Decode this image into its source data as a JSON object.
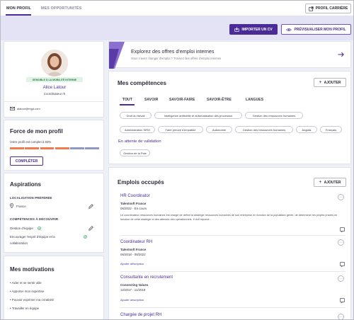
{
  "topnav": {
    "tabs": [
      {
        "label": "MON PROFIL",
        "active": true
      },
      {
        "label": "MES OPPORTUNITÉS",
        "active": false
      }
    ],
    "career_profile_button": "PROFIL CARRIÈRE"
  },
  "band": {
    "import_cv_button": "IMPORTER UN CV",
    "preview_button": "PRÉVISUALISER MON PROFIL"
  },
  "profile": {
    "badge": "SENSIBLE À LA MOBILITÉ INTERNE",
    "name": "Alice Latour",
    "role": "Coordinateur rh",
    "email": "alatour@mgd.com"
  },
  "strength": {
    "title": "Force de mon profil",
    "text": "Votre profil est complet à 83%",
    "percent": 83,
    "segment_colors": [
      "#f07b4f",
      "#f07b4f",
      "#f07b4f",
      "#f07b4f",
      "#8f96c8",
      "#8f96c8"
    ],
    "complete_button": "COMPLÉTER"
  },
  "aspirations": {
    "title": "Aspirations",
    "location_label": "LOCALISATION PRÉFÉRÉE",
    "location_value": "France",
    "skills_label": "COMPÉTENCES À DÉCOUVRIR",
    "skills": [
      "Gestion d'équipe",
      "Encourager l'esprit d'équipe et la",
      "collaboration"
    ]
  },
  "motivations": {
    "title": "Mes motivations",
    "items": [
      "Aider et se sentir utile",
      "Apporter mon expertise",
      "Pouvoir exprimer ma créativité",
      "Travailler en équipe"
    ]
  },
  "explore": {
    "title": "Explorez des offres d'emploi internes",
    "subtitle": "Vous n'avez changer d'emploi ? Trouvez des offres d'emploi internes"
  },
  "skills": {
    "title": "Mes compétences",
    "add_button": "AJOUTER",
    "tabs": [
      "TOUT",
      "SAVOIR",
      "SAVOIR-FAIRE",
      "SAVOIR-ÊTRE",
      "LANGUES"
    ],
    "chips_row1": [
      "Droit du travail",
      "Intelligence artificielle et automatisation des processus",
      "Gestion des ressources humaines"
    ],
    "chips_row2": [
      "Administration SIRH",
      "Faire preuve d'empathie",
      "Autonomie",
      "Gestion des ressources humaines",
      "Anglais",
      "Français"
    ],
    "pending_label": "En attente de validation",
    "pending_chips": [
      "Gestion de la Paie"
    ]
  },
  "jobs": {
    "title": "Emplois occupés",
    "add_button": "AJOUTER",
    "items": [
      {
        "title": "HR Coordinator",
        "company": "Talentsoft France",
        "dates": "06/2022 - En cours",
        "description": "Le coordinateur ressources humaines est chargé de définir la stratégie ressources humaines de son entreprise en fonction de la population gérée, de déterminer les projets phares en fonction de cette stratégie et des attentes des opérationnels. Il doit répondr..."
      },
      {
        "title": "Coordinateur RH",
        "company": "Talentsoft France",
        "dates": "06/2018 - 08/2022",
        "description": "Ajouter description"
      },
      {
        "title": "Consultante en recrutement",
        "company": "Connecting Values",
        "dates": "12/2017 - 11/2019",
        "description": "Ajouter description"
      },
      {
        "title": "Chargée de projet RH",
        "company": "",
        "dates": "",
        "description": ""
      }
    ]
  },
  "colors": {
    "brand": "#4b2c96",
    "band": "#e3e3f5",
    "badge_bg": "#dff3e4",
    "badge_text": "#2b7a45",
    "accent_orange": "#f07b4f"
  }
}
